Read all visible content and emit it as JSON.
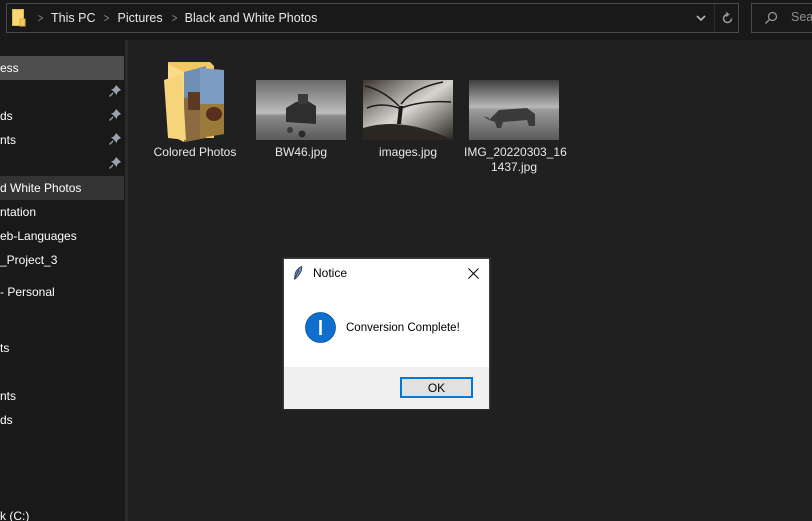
{
  "address_bar": {
    "breadcrumbs": [
      "This PC",
      "Pictures",
      "Black and White Photos"
    ],
    "icons": {
      "location": "folder-icon",
      "dropdown": "chevron-down-icon",
      "refresh": "refresh-icon"
    }
  },
  "search": {
    "placeholder": "Search",
    "visible_text": "Sear",
    "icon": "search-icon"
  },
  "sidebar": {
    "items": [
      {
        "label": "ess",
        "state": "selected",
        "pinned": false
      },
      {
        "label": "",
        "pinned": true
      },
      {
        "label": "ds",
        "pinned": true
      },
      {
        "label": "nts",
        "pinned": true
      },
      {
        "label": "",
        "pinned": true
      },
      {
        "label": "d White Photos",
        "state": "current",
        "pinned": false
      },
      {
        "label": "ntation",
        "pinned": false
      },
      {
        "label": "eb-Languages",
        "pinned": false
      },
      {
        "label": "_Project_3",
        "pinned": false
      },
      {
        "label": "- Personal",
        "pinned": false
      },
      {
        "label": "ts",
        "pinned": false
      },
      {
        "label": "nts",
        "pinned": false
      },
      {
        "label": "ds",
        "pinned": false
      },
      {
        "label": "k (C:)",
        "pinned": false
      }
    ]
  },
  "files": [
    {
      "name": "Colored Photos",
      "type": "folder",
      "icon": "folder-with-photos-icon"
    },
    {
      "name": "BW46.jpg",
      "type": "image",
      "thumbnail": "bw-house-thumbnail"
    },
    {
      "name": "images.jpg",
      "type": "image",
      "thumbnail": "bw-tree-thumbnail"
    },
    {
      "name": "IMG_20220303_161437.jpg",
      "display_lines": [
        "IMG_20220303_16",
        "1437.jpg"
      ],
      "type": "image",
      "thumbnail": "bw-rhino-thumbnail"
    }
  ],
  "dialog": {
    "title": "Notice",
    "message": "Conversion Complete!",
    "ok_label": "OK",
    "icons": {
      "title": "feather-icon",
      "close": "close-icon",
      "info": "info-icon"
    },
    "accent_color": "#0078d7"
  },
  "colors": {
    "background": "#191919",
    "content_background": "#202020",
    "selected_item": "#4d4d4d",
    "folder_yellow": "#f3d47b",
    "dialog_accent": "#0078d7"
  }
}
